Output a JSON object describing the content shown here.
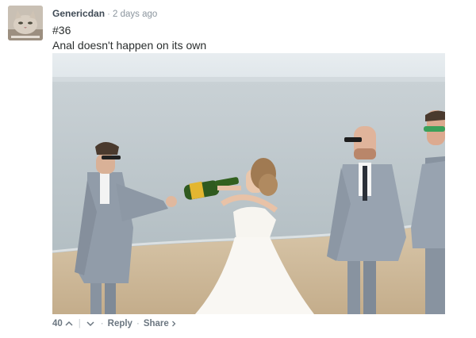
{
  "comment": {
    "username": "Genericdan",
    "separator": "·",
    "timestamp": "2 days ago",
    "lines": [
      "#36",
      "Anal doesn't happen on its own"
    ],
    "avatar_icon": "cat-photo-avatar",
    "photo_icon": "beach-wedding-photo"
  },
  "footer": {
    "votes": "40",
    "upvote_icon": "chevron-up-icon",
    "downvote_icon": "chevron-down-icon",
    "dot": "·",
    "reply": "Reply",
    "share": "Share",
    "share_icon": "chevron-right-icon"
  },
  "colors": {
    "username": "#3f4a55",
    "meta": "#8b959e",
    "body_text": "#2a2e2e",
    "suit": "#8f9aa7",
    "sand": "#cdb89a",
    "sea": "#b9c3c8"
  }
}
